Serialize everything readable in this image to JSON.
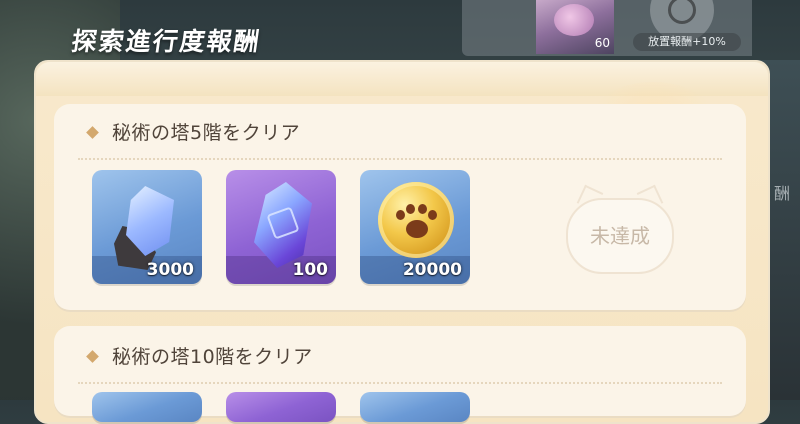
{
  "title": "探索進行度報酬",
  "top_panel": {
    "portrait_value": "60",
    "bonus_label": "放置報酬+10%"
  },
  "side_text": "酬",
  "rewards": [
    {
      "title": "秘術の塔5階をクリア",
      "items": [
        {
          "icon": "blue-crystal-ore-icon",
          "quantity": "3000",
          "rarity": "blue"
        },
        {
          "icon": "purple-crystal-icon",
          "quantity": "100",
          "rarity": "purple"
        },
        {
          "icon": "gold-paw-coin-icon",
          "quantity": "20000",
          "rarity": "blue"
        }
      ],
      "status": "未達成"
    },
    {
      "title": "秘術の塔10階をクリア"
    }
  ]
}
